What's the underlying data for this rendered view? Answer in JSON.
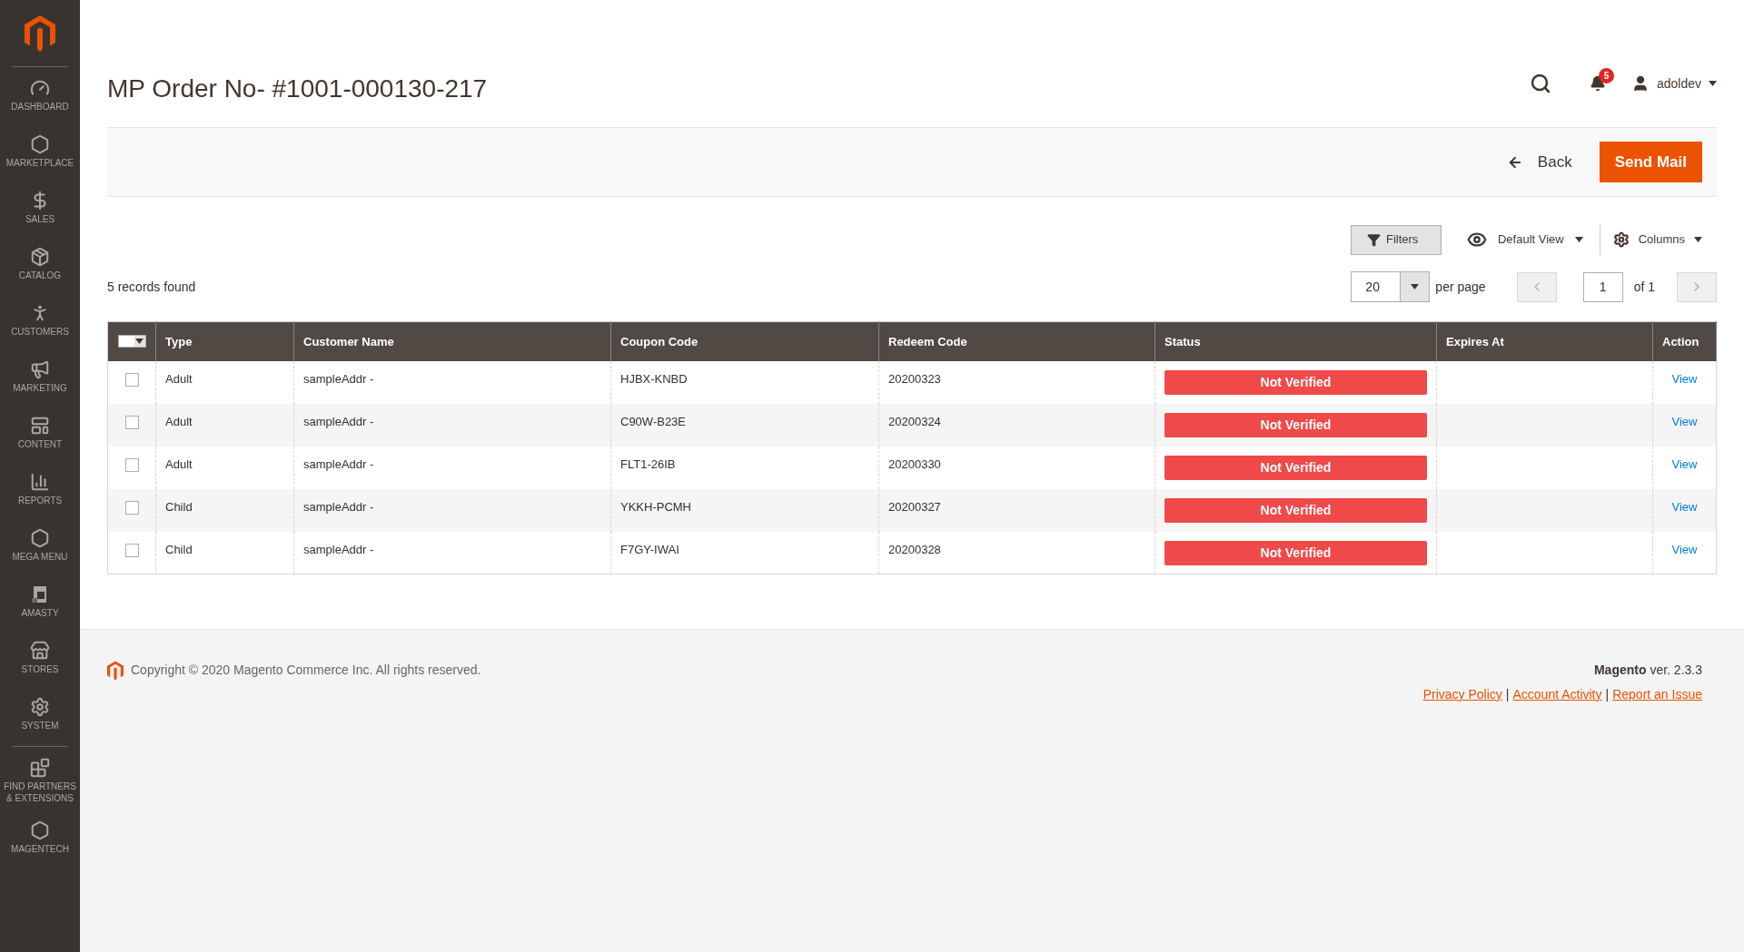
{
  "sidebar": {
    "items": [
      {
        "label": "DASHBOARD",
        "divider_before": false
      },
      {
        "label": "MARKETPLACE",
        "divider_before": false
      },
      {
        "label": "SALES",
        "divider_before": false
      },
      {
        "label": "CATALOG",
        "divider_before": false
      },
      {
        "label": "CUSTOMERS",
        "divider_before": false
      },
      {
        "label": "MARKETING",
        "divider_before": false
      },
      {
        "label": "CONTENT",
        "divider_before": false
      },
      {
        "label": "REPORTS",
        "divider_before": false
      },
      {
        "label": "MEGA MENU",
        "divider_before": false
      },
      {
        "label": "AMASTY",
        "divider_before": false
      },
      {
        "label": "STORES",
        "divider_before": false
      },
      {
        "label": "SYSTEM",
        "divider_before": false
      },
      {
        "label": "FIND PARTNERS & EXTENSIONS",
        "divider_before": true
      },
      {
        "label": "MAGENTECH",
        "divider_before": false
      }
    ]
  },
  "header": {
    "title": "MP Order No- #1001-000130-217",
    "notifications": "5",
    "user": "adoldev"
  },
  "actions": {
    "back": "Back",
    "send": "Send Mail"
  },
  "toolbar": {
    "filters": "Filters",
    "view": "Default View",
    "columns": "Columns",
    "records": "5 records found",
    "per_page_value": "20",
    "per_page_label": "per page",
    "page": "1",
    "of_pages": "of 1"
  },
  "table": {
    "columns": [
      "Type",
      "Customer Name",
      "Coupon Code",
      "Redeem Code",
      "Status",
      "Expires At",
      "Action"
    ],
    "rows": [
      {
        "checked": false,
        "type": "Adult",
        "customer": "sampleAddr -",
        "coupon": "HJBX-KNBD",
        "redeem": "20200323",
        "status": "Not Verified",
        "action": "View"
      },
      {
        "checked": false,
        "type": "Adult",
        "customer": "sampleAddr -",
        "coupon": "C90W-B23E",
        "redeem": "20200324",
        "status": "Not Verified",
        "action": "View"
      },
      {
        "checked": false,
        "type": "Adult",
        "customer": "sampleAddr -",
        "coupon": "FLT1-26IB",
        "redeem": "20200330",
        "status": "Not Verified",
        "action": "View"
      },
      {
        "checked": false,
        "type": "Child",
        "customer": "sampleAddr -",
        "coupon": "YKKH-PCMH",
        "redeem": "20200327",
        "status": "Not Verified",
        "action": "View"
      },
      {
        "checked": false,
        "type": "Child",
        "customer": "sampleAddr -",
        "coupon": "F7GY-IWAI",
        "redeem": "20200328",
        "status": "Not Verified",
        "action": "View"
      }
    ]
  },
  "footer": {
    "copyright": "Copyright © 2020 Magento Commerce Inc. All rights reserved.",
    "version": "**Magento** ver. 2.3.3",
    "links": [
      "Privacy Policy",
      "Account Activity",
      "Report an Issue"
    ],
    "separators": [
      "|",
      "|"
    ]
  }
}
